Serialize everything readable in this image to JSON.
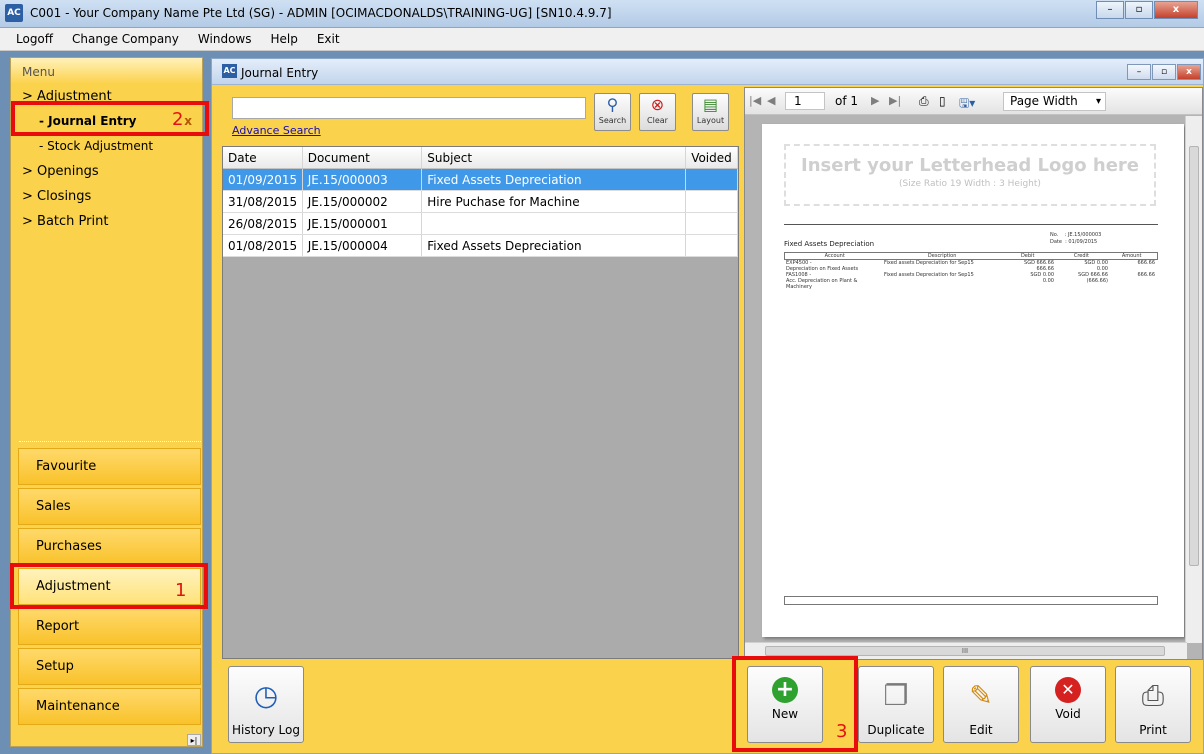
{
  "app": {
    "icon_text": "AC",
    "title": "C001 - Your Company Name Pte Ltd (SG) - ADMIN [OCIMACDONALDS\\TRAINING-UG] [SN10.4.9.7]",
    "window_controls": [
      "–",
      "▫",
      "x"
    ]
  },
  "menubar": [
    "Logoff",
    "Change Company",
    "Windows",
    "Help",
    "Exit"
  ],
  "sidebar": {
    "header": "Menu",
    "tree": [
      {
        "label": "> Adjustment",
        "level": 0
      },
      {
        "label": "- Journal Entry",
        "level": 1,
        "selected": true,
        "close": "x"
      },
      {
        "label": "- Stock Adjustment",
        "level": 1
      },
      {
        "label": "> Openings",
        "level": 0
      },
      {
        "label": "> Closings",
        "level": 0
      },
      {
        "label": "> Batch Print",
        "level": 0
      }
    ],
    "nav_buttons": [
      "Favourite",
      "Sales",
      "Purchases",
      "Adjustment",
      "Report",
      "Setup",
      "Maintenance"
    ],
    "active_nav": "Adjustment"
  },
  "annotations": {
    "step1": "1",
    "step2": "2",
    "step3": "3",
    "highlight_color": "#e80c0c"
  },
  "journal": {
    "icon_text": "AC",
    "title": "Journal Entry",
    "search_value": "",
    "advance_search": "Advance Search",
    "tools": [
      {
        "name": "search",
        "caption": "Search"
      },
      {
        "name": "clear",
        "caption": "Clear"
      },
      {
        "name": "layout",
        "caption": "Layout"
      }
    ],
    "table": {
      "columns": [
        "Date",
        "Document",
        "Subject",
        "Voided"
      ],
      "rows": [
        [
          "01/09/2015",
          "JE.15/000003",
          "Fixed Assets Depreciation",
          ""
        ],
        [
          "31/08/2015",
          "JE.15/000002",
          "Hire Puchase for Machine",
          ""
        ],
        [
          "26/08/2015",
          "JE.15/000001",
          "",
          ""
        ],
        [
          "01/08/2015",
          "JE.15/000004",
          "Fixed Assets Depreciation",
          ""
        ]
      ],
      "selected_row": 0
    },
    "preview": {
      "page_current": "1",
      "page_of": "of 1",
      "zoom": "Page Width",
      "document": {
        "logo_main": "Insert your Letterhead Logo here",
        "logo_sub": "(Size Ratio 19 Width : 3 Height)",
        "meta_no_label": "No.",
        "meta_no_value": ": JE.15/000003",
        "meta_date_label": "Date",
        "meta_date_value": ": 01/09/2015",
        "subject": "Fixed Assets Depreciation",
        "columns": [
          "Account",
          "Description",
          "Debit",
          "Credit",
          "Amount"
        ],
        "lines": [
          [
            "EXP4500 -",
            "Fixed assets Depreciation for Sep15",
            "SGD 666.66",
            "SGD 0.00",
            "666.66"
          ],
          [
            "Depreciation on Fixed Assets",
            "",
            "666.66",
            "0.00",
            ""
          ],
          [
            "FAS1008 -",
            "Fixed assets Depreciation for Sep15",
            "SGD 0.00",
            "SGD 666.66",
            "666.66"
          ],
          [
            "Acc. Depreciation on Plant &",
            "",
            "0.00",
            "(666.66)",
            ""
          ],
          [
            "Machinery",
            "",
            "",
            "",
            ""
          ]
        ]
      },
      "hscroll_label": "III"
    },
    "actions": [
      "History Log",
      "New",
      "Duplicate",
      "Edit",
      "Void",
      "Print"
    ]
  }
}
